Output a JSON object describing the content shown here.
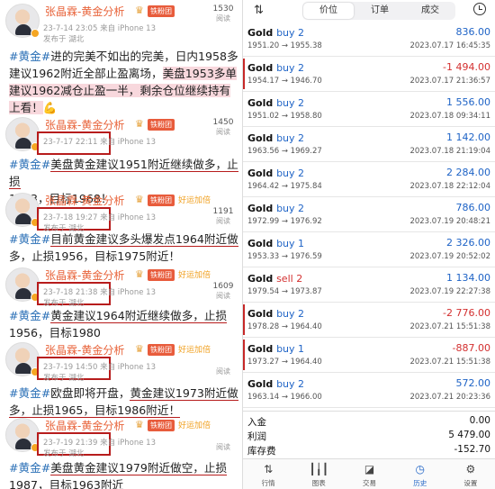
{
  "feed": {
    "cards": [
      {
        "user": "张晶霖-黄金分析",
        "badge": "铁粉团",
        "time": "23-7-14 23:05",
        "via": "来自 iPhone 13",
        "location": "发布于 湖北",
        "read_count": "1530",
        "read_label": "阅读"
      },
      {
        "user": "张晶霖-黄金分析",
        "badge": "铁粉团",
        "time": "23-7-17 22:11",
        "via": "来自 iPhone 13",
        "location": "",
        "read_count": "1450",
        "read_label": "阅读"
      },
      {
        "user": "张晶霖-黄金分析",
        "badge": "铁粉团",
        "time": "23-7-18 19:27",
        "via": "来自 iPhone 13",
        "location": "发布于 湖北",
        "read_count": "1191",
        "read_label": "阅读"
      },
      {
        "user": "张晶霖-黄金分析",
        "badge": "铁粉团",
        "time": "23-7-18 21:38",
        "via": "来自 iPhone 13",
        "location": "发布于 湖北",
        "read_count": "1609",
        "read_label": "阅读"
      },
      {
        "user": "张晶霖-黄金分析",
        "badge": "铁粉团",
        "time": "23-7-19 14:50",
        "via": "来自 iPhone 13",
        "location": "发布于 湖北",
        "read_count": "",
        "read_label": "阅读"
      },
      {
        "user": "张晶霖-黄金分析",
        "badge": "铁粉团",
        "time": "23-7-19 21:39",
        "via": "来自 iPhone 13",
        "location": "发布于 湖北",
        "read_count": "",
        "read_label": "阅读"
      }
    ],
    "promo": "好运加倍",
    "posts": [
      {
        "hash": "#黄金#",
        "a": "进的完美不如出的完美，日内1958多建议1962附近全部止盈离场，",
        "b": "美盘1953多单建议1962减仓止盈一半，剩余仓位继续持有上看！",
        "c": "💪"
      },
      {
        "hash": "#黄金#",
        "a": "美盘黄金建议1951附近继续做多，止损",
        "b": "1943，目标1968！"
      },
      {
        "hash": "#黄金#",
        "a": "目前黄金建议多头爆发点1964附近做",
        "b": "多，止损1956，目标1975附近！"
      },
      {
        "hash": "#黄金#",
        "a": "黄金建议1964附近继续做多，止损",
        "b": "1956，目标1980"
      },
      {
        "hash": "#黄金#",
        "a": "欧盘即将开盘，",
        "b": "黄金建议1973附近做多，止损1965，目标1986附近！"
      },
      {
        "hash": "#黄金#",
        "a": "美盘黄金建议1979附近做空，止损",
        "b": "1987，目标1963附近"
      }
    ]
  },
  "terminal": {
    "tabs": [
      "价位",
      "订单",
      "成交"
    ],
    "active_tab": "价位",
    "trades": [
      {
        "symbol": "Gold",
        "side": "buy",
        "lots": "2",
        "prices": "1951.20 → 1955.38",
        "profit": "836.00",
        "time": "2023.07.17 16:45:35"
      },
      {
        "symbol": "Gold",
        "side": "buy",
        "lots": "2",
        "prices": "1954.17 → 1946.70",
        "profit": "-1 494.00",
        "time": "2023.07.17 21:36:57"
      },
      {
        "symbol": "Gold",
        "side": "buy",
        "lots": "2",
        "prices": "1951.02 → 1958.80",
        "profit": "1 556.00",
        "time": "2023.07.18 09:34:11"
      },
      {
        "symbol": "Gold",
        "side": "buy",
        "lots": "2",
        "prices": "1963.56 → 1969.27",
        "profit": "1 142.00",
        "time": "2023.07.18 21:19:04"
      },
      {
        "symbol": "Gold",
        "side": "buy",
        "lots": "2",
        "prices": "1964.42 → 1975.84",
        "profit": "2 284.00",
        "time": "2023.07.18 22:12:04"
      },
      {
        "symbol": "Gold",
        "side": "buy",
        "lots": "2",
        "prices": "1972.99 → 1976.92",
        "profit": "786.00",
        "time": "2023.07.19 20:48:21"
      },
      {
        "symbol": "Gold",
        "side": "buy",
        "lots": "1",
        "prices": "1953.33 → 1976.59",
        "profit": "2 326.00",
        "time": "2023.07.19 20:52:02"
      },
      {
        "symbol": "Gold",
        "side": "sell",
        "lots": "2",
        "prices": "1979.54 → 1973.87",
        "profit": "1 134.00",
        "time": "2023.07.19 22:27:38"
      },
      {
        "symbol": "Gold",
        "side": "buy",
        "lots": "2",
        "prices": "1978.28 → 1964.40",
        "profit": "-2 776.00",
        "time": "2023.07.21 15:51:38"
      },
      {
        "symbol": "Gold",
        "side": "buy",
        "lots": "1",
        "prices": "1973.27 → 1964.40",
        "profit": "-887.00",
        "time": "2023.07.21 15:51:38"
      },
      {
        "symbol": "Gold",
        "side": "buy",
        "lots": "2",
        "prices": "1963.14 → 1966.00",
        "profit": "572.00",
        "time": "2023.07.21 20:23:36"
      }
    ],
    "summary": [
      {
        "label": "入金",
        "value": "0.00"
      },
      {
        "label": "利润",
        "value": "5 479.00"
      },
      {
        "label": "库存费",
        "value": "-152.70"
      }
    ],
    "nav": [
      {
        "icon": "arrows-icon",
        "label": "行情"
      },
      {
        "icon": "candles-icon",
        "label": "图表"
      },
      {
        "icon": "chart-line-icon",
        "label": "交易"
      },
      {
        "icon": "history-clock-icon",
        "label": "历史"
      },
      {
        "icon": "gear-icon",
        "label": "设置"
      }
    ],
    "active_nav": "历史",
    "colors": {
      "profit": "#1e63c6",
      "loss": "#d32f2f",
      "accent": "#1e63c6"
    }
  }
}
